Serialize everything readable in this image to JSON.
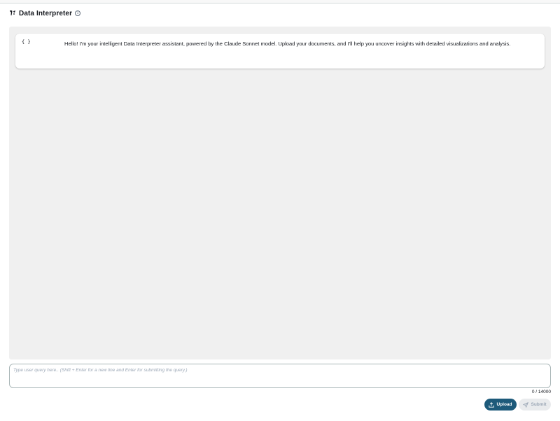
{
  "header": {
    "title": "Data Interpreter",
    "logo_icon": "beaker-logo-icon",
    "info_icon": "info-icon",
    "info_glyph": "i"
  },
  "chat": {
    "messages": [
      {
        "avatar": "{ }",
        "text": "Hello! I'm your intelligent Data Interpreter assistant, powered by the Claude Sonnet model. Upload your documents, and I'll help you uncover insights with detailed visualizations and analysis."
      }
    ]
  },
  "composer": {
    "placeholder": "Type user query here.. (Shift + Enter for a new line and Enter for submitting the query.)",
    "value": "",
    "counter": "0 / 14000",
    "upload_label": "Upload",
    "submit_label": "Submit",
    "upload_icon": "upload-icon",
    "submit_icon": "send-icon"
  },
  "colors": {
    "accent": "#1d5a7a",
    "chat_background": "#f0f0f0",
    "disabled": "#e9ebed"
  }
}
